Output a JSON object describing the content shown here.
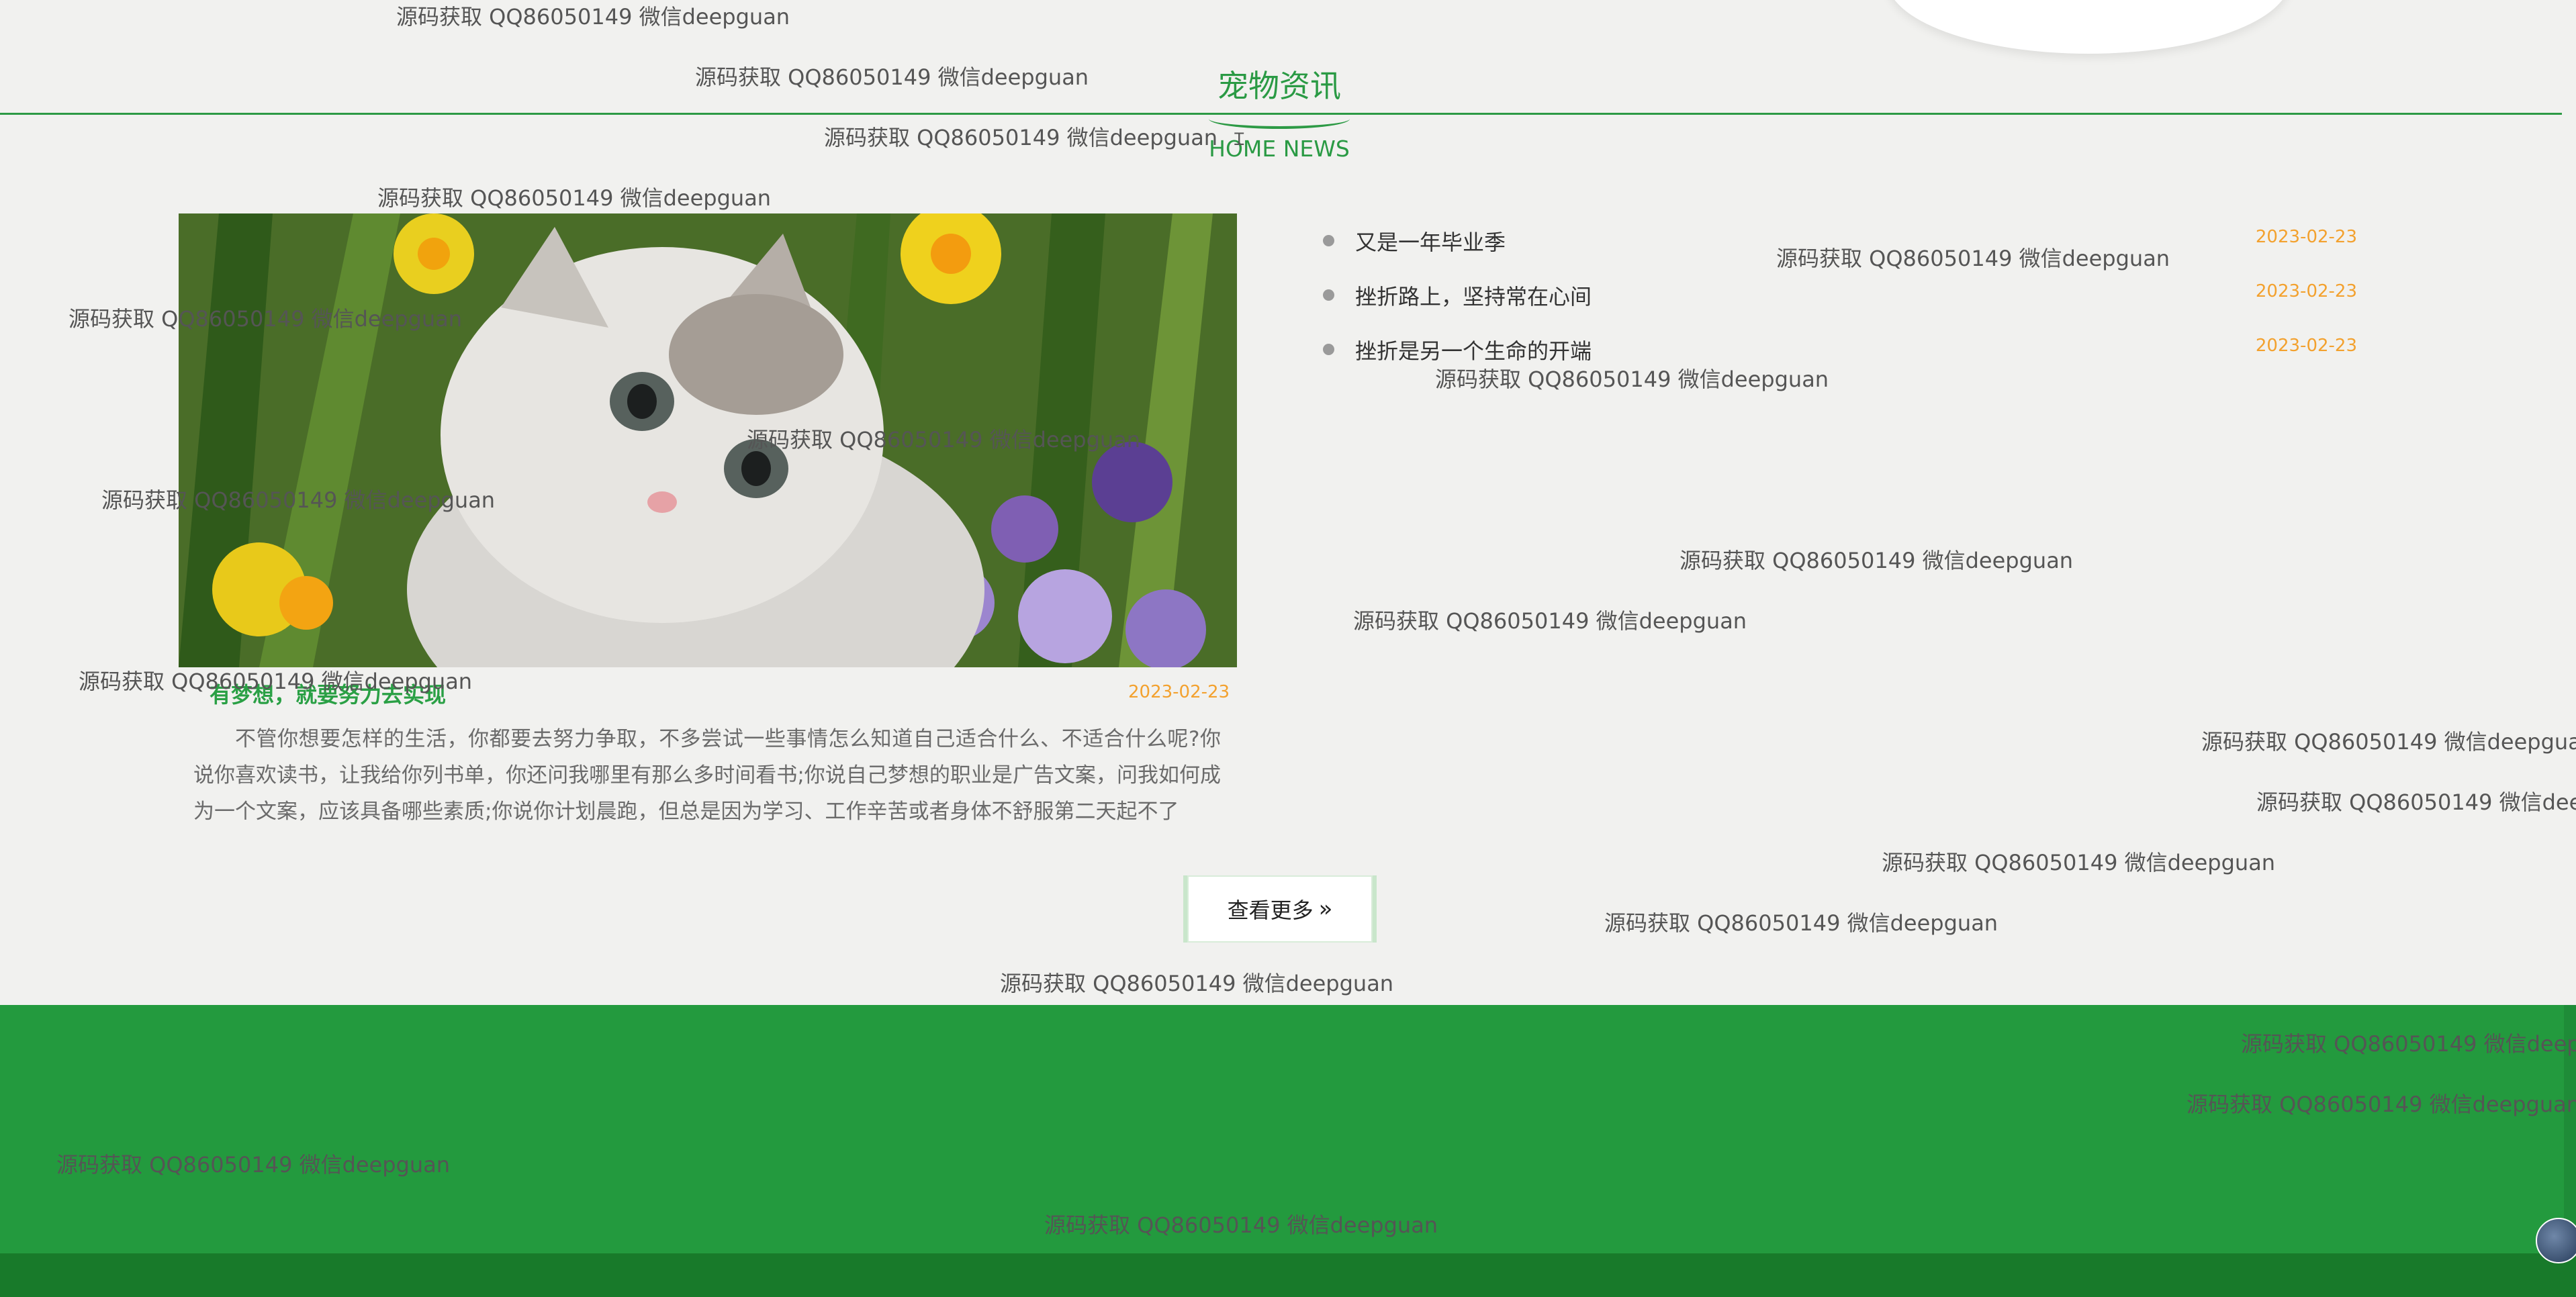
{
  "section": {
    "title": "宠物资讯",
    "subtitle": "HOME NEWS"
  },
  "featured": {
    "title": "有梦想，就要努力去实现",
    "date": "2023-02-23",
    "body": "不管你想要怎样的生活，你都要去努力争取，不多尝试一些事情怎么知道自己适合什么、不适合什么呢?你说你喜欢读书，让我给你列书单，你还问我哪里有那么多时间看书;你说自己梦想的职业是广告文案，问我如何成为一个文案，应该具备哪些素质;你说你计划晨跑，但总是因为学习、工作辛苦或者身体不舒服第二天起不了"
  },
  "news": [
    {
      "title": "又是一年毕业季",
      "date": "2023-02-23"
    },
    {
      "title": "挫折路上，坚持常在心间",
      "date": "2023-02-23"
    },
    {
      "title": "挫折是另一个生命的开端",
      "date": "2023-02-23"
    }
  ],
  "more_button": {
    "label": "查看更多",
    "icon": "double-chevron-right-icon"
  },
  "watermarks": [
    "源码获取 QQ86050149 微信deepguan",
    "源码获取 QQ86050149 微信deepguan",
    "源码获取 QQ86050149 微信deepguan",
    "源码获取 QQ86050149 微信deepguan",
    "源码获取 QQ86050149 微信deepguan",
    "源码获取 QQ86050149 微信deepguan",
    "源码获取 QQ86050149 微信deepguan",
    "源码获取 QQ86050149 微信deepguan",
    "源码获取 QQ86050149 微信deepguan",
    "源码获取 QQ86050149 微信deepguan",
    "源码获取 QQ86050149 微信deepguan",
    "源码获取 QQ86050149 微信deepguan",
    "源码获取 QQ86050149 微信deepguan",
    "源码获取 QQ86050149 微信deepguan",
    "源码获取 QQ86050149 微信deepguan",
    "源码获取 QQ86050149 微信deepguan",
    "源码获取 QQ86050149 微信deepguan",
    "源码获取 QQ86050149 微信deepguan",
    "源码获取 QQ86050149 微信deepguan",
    "源码获取 QQ86050149 微信deepguan",
    "源码获取 QQ86050149 微信deepguan"
  ],
  "colors": {
    "accent": "#2a9a44",
    "date": "#f3a12e",
    "footer": "#239a3e",
    "footer_bottom": "#187a2a"
  }
}
